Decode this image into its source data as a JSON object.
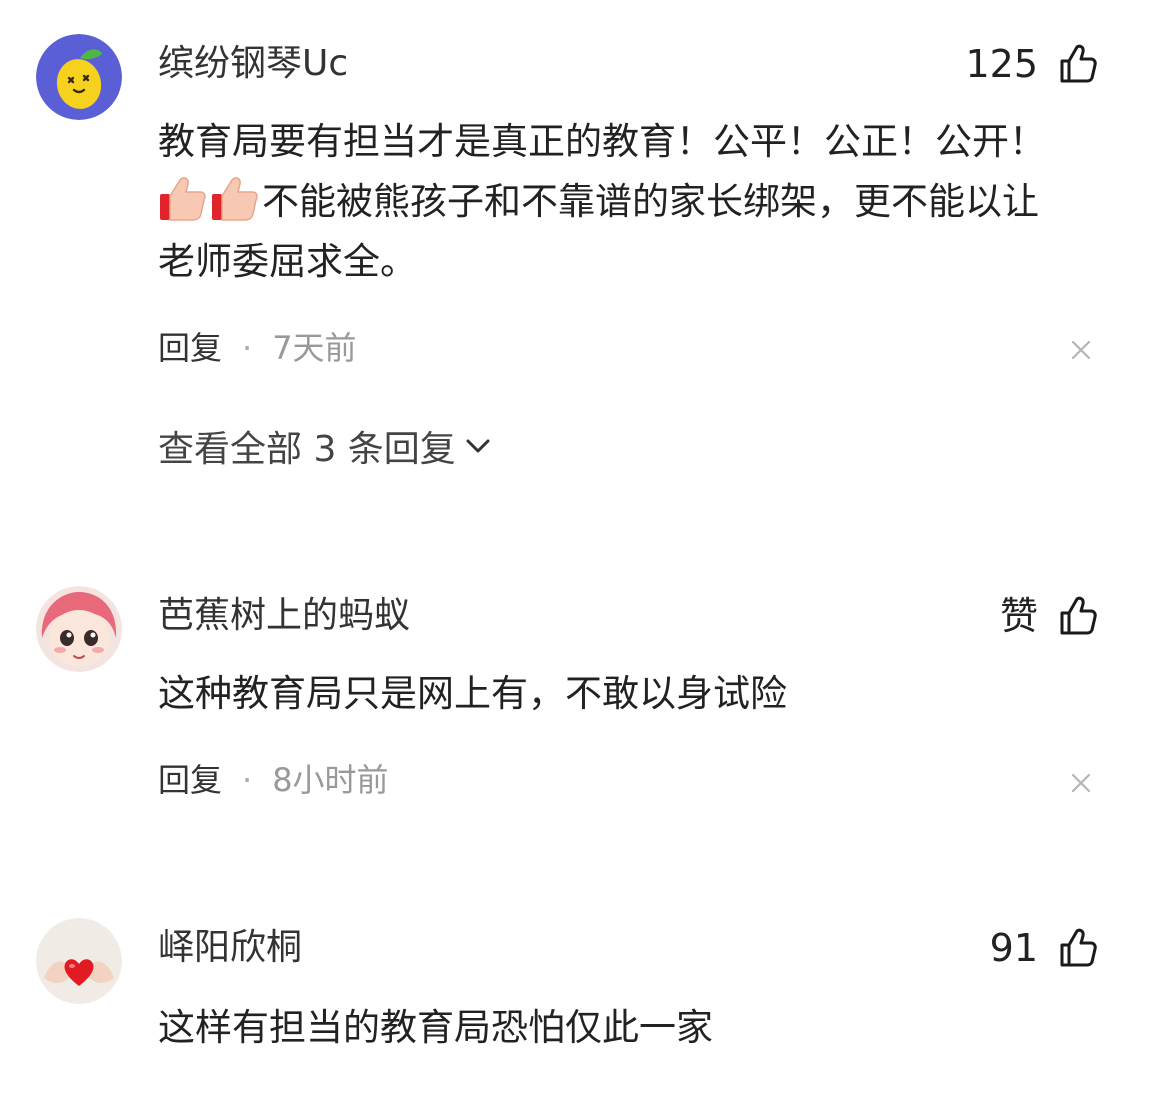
{
  "comments": [
    {
      "username": "缤纷钢琴Uc",
      "like_label": "125",
      "text_line1": "教育局要有担当才是真正的教育！公平！公正！公开！",
      "text_line2": "不能被熊孩子和不靠谱的家长绑架，更不能以让",
      "text_line3": "老师委屈求全。",
      "reply_label": "回复",
      "time": "7天前",
      "expand_label": "查看全部 3 条回复"
    },
    {
      "username": "芭蕉树上的蚂蚁",
      "like_label": "赞",
      "text_line1": "这种教育局只是网上有，不敢以身试险",
      "reply_label": "回复",
      "time": "8小时前"
    },
    {
      "username": "峄阳欣桐",
      "like_label": "91",
      "text_line1": "这样有担当的教育局恐怕仅此一家"
    }
  ],
  "icons": {
    "like": "thumbs-up-icon",
    "close": "close-icon",
    "chevron": "chevron-down-icon",
    "emoji": "thumbs-up-emoji"
  },
  "colors": {
    "text": "#222222",
    "muted": "#999999",
    "icon": "#1a1a1a",
    "avatar1_bg": "#5b5fd6",
    "avatar1_fruit": "#f6d21f",
    "avatar3_heart": "#e21b23"
  }
}
